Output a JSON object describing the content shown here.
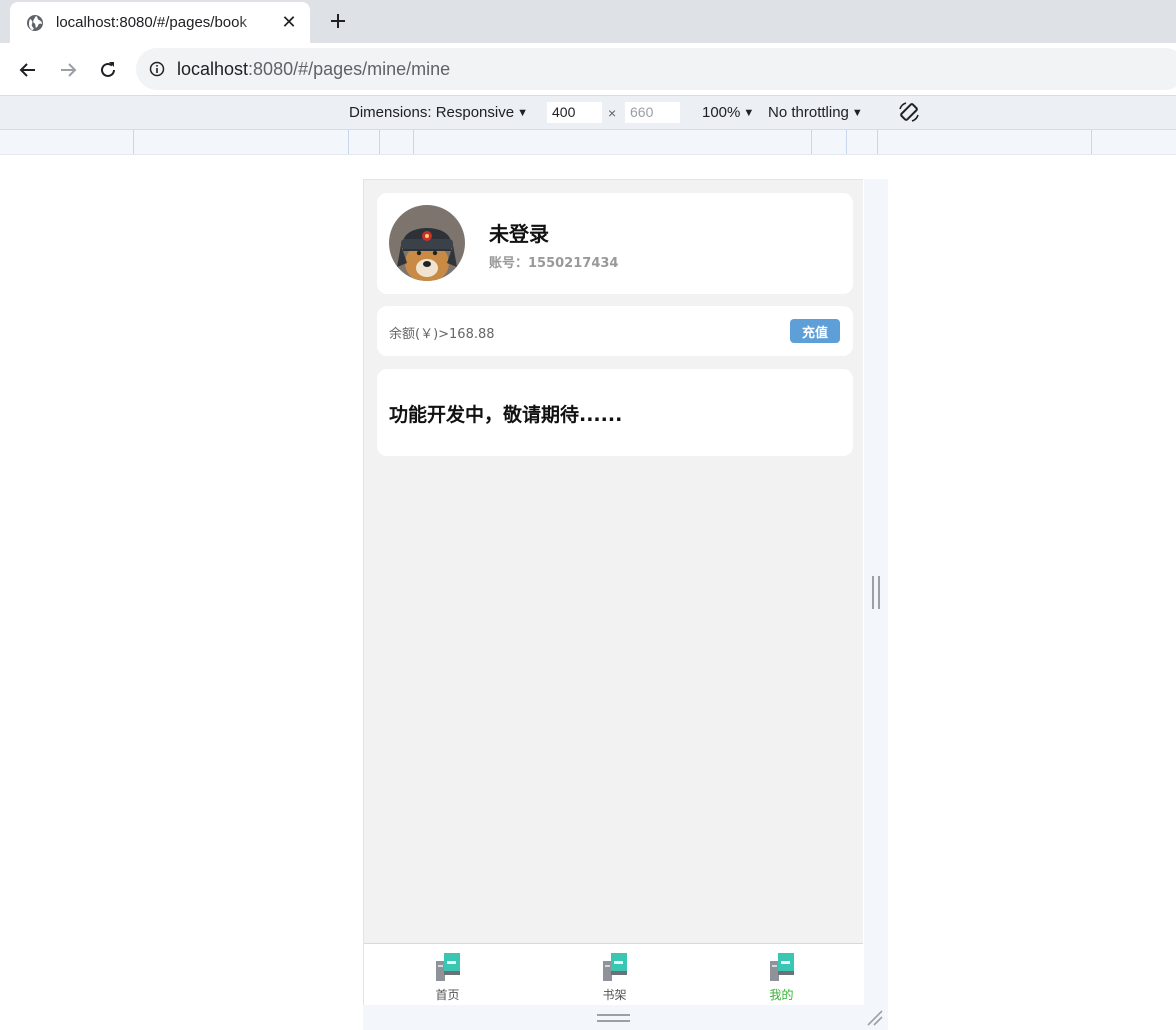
{
  "browser": {
    "tab": {
      "title": "localhost:8080/#/pages/book",
      "icon": "globe-icon",
      "close": "✕"
    },
    "new_tab_icon": "plus-icon",
    "nav": {
      "back": "arrow-left-icon",
      "forward": "arrow-right-icon",
      "reload": "reload-icon"
    },
    "omnibox": {
      "host": "localhost",
      "rest": ":8080/#/pages/mine/mine",
      "icon": "info-icon"
    }
  },
  "device_toolbar": {
    "dimensions_label": "Dimensions: Responsive",
    "width": "400",
    "height_placeholder": "660",
    "times": "×",
    "zoom": "100%",
    "throttling": "No throttling",
    "rotate_icon": "rotate-icon"
  },
  "app": {
    "profile": {
      "name": "未登录",
      "account": "账号：1550217434"
    },
    "balance": {
      "text": "余额(￥)>168.88",
      "button": "充值"
    },
    "notice": "功能开发中，敬请期待......",
    "tabbar": [
      {
        "label": "首页",
        "active": false
      },
      {
        "label": "书架",
        "active": false
      },
      {
        "label": "我的",
        "active": true
      }
    ],
    "colors": {
      "active_tab": "#35b233",
      "recharge_button": "#5f9fd7",
      "background": "#f2f2f2"
    }
  }
}
